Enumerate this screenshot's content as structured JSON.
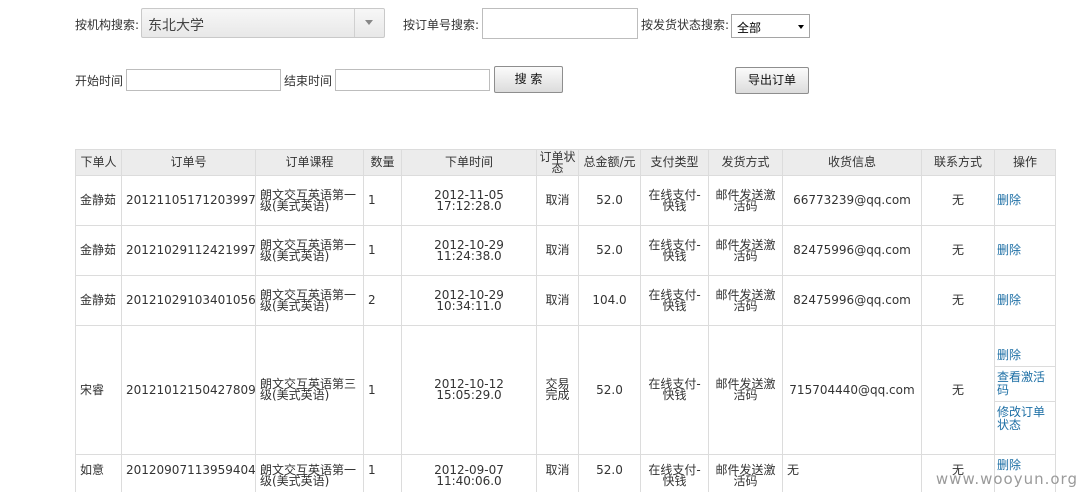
{
  "filters": {
    "org_label": "按机构搜索:",
    "org_value": "东北大学",
    "order_no_label": "按订单号搜索:",
    "order_no_value": "",
    "status_label": "按发货状态搜索:",
    "status_value": "全部",
    "start_label": "开始时间",
    "start_value": "",
    "end_label": "结束时间",
    "end_value": "",
    "search_label": "搜 索",
    "export_label": "导出订单"
  },
  "table": {
    "headers": [
      "下单人",
      "订单号",
      "订单课程",
      "数量",
      "下单时间",
      "订单状态",
      "总金额/元",
      "支付类型",
      "发货方式",
      "收货信息",
      "联系方式",
      "操作"
    ],
    "rows": [
      {
        "buyer": "金静茹",
        "order_no": "20121105171203997",
        "course": "朗文交互英语第一级(美式英语)",
        "qty": "1",
        "time": "2012-11-05 17:12:28.0",
        "status": "取消",
        "amount": "52.0",
        "pay": "在线支付-快钱",
        "ship": "邮件发送激活码",
        "info": "66773239@qq.com",
        "contact": "无",
        "ops": [
          "删除"
        ]
      },
      {
        "buyer": "金静茹",
        "order_no": "20121029112421997",
        "course": "朗文交互英语第一级(美式英语)",
        "qty": "1",
        "time": "2012-10-29 11:24:38.0",
        "status": "取消",
        "amount": "52.0",
        "pay": "在线支付-快钱",
        "ship": "邮件发送激活码",
        "info": "82475996@qq.com",
        "contact": "无",
        "ops": [
          "删除"
        ]
      },
      {
        "buyer": "金静茹",
        "order_no": "20121029103401056",
        "course": "朗文交互英语第一级(美式英语)",
        "qty": "2",
        "time": "2012-10-29 10:34:11.0",
        "status": "取消",
        "amount": "104.0",
        "pay": "在线支付-快钱",
        "ship": "邮件发送激活码",
        "info": "82475996@qq.com",
        "contact": "无",
        "ops": [
          "删除"
        ]
      },
      {
        "buyer": "宋睿",
        "order_no": "20121012150427809",
        "course": "朗文交互英语第三级(美式英语)",
        "qty": "1",
        "time": "2012-10-12 15:05:29.0",
        "status": "交易完成",
        "amount": "52.0",
        "pay": "在线支付-快钱",
        "ship": "邮件发送激活码",
        "info": "715704440@qq.com",
        "contact": "无",
        "ops": [
          "删除",
          "查看激活码",
          "修改订单状态"
        ]
      },
      {
        "buyer": "如意",
        "order_no": "20120907113959404",
        "course": "朗文交互英语第一级(美式英语)",
        "qty": "1",
        "time": "2012-09-07 11:40:06.0",
        "status": "取消",
        "amount": "52.0",
        "pay": "在线支付-快钱",
        "ship": "邮件发送激活码",
        "info": "无",
        "contact": "无",
        "ops": [
          "删除"
        ]
      }
    ]
  },
  "watermark": "www.wooyun.org"
}
